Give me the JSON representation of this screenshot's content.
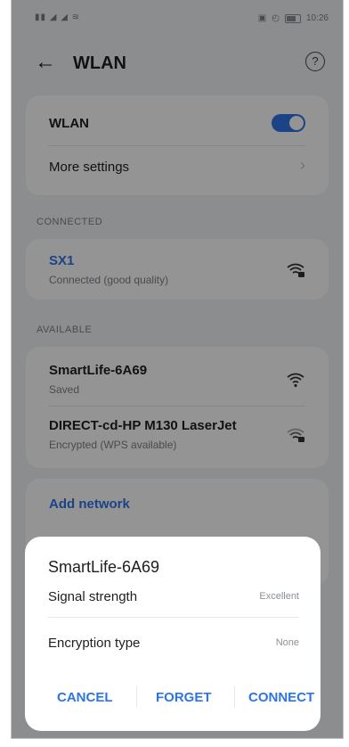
{
  "status_bar": {
    "left_icons": "▮▮ ◢ ◢ ≋",
    "time": "10:26"
  },
  "header": {
    "back_icon": "arrow-left-icon",
    "title": "WLAN",
    "help_icon": "help-icon"
  },
  "wlan_card": {
    "wlan_label": "WLAN",
    "wlan_enabled": true,
    "more_settings_label": "More settings"
  },
  "sections": {
    "connected_title": "CONNECTED",
    "available_title": "AVAILABLE"
  },
  "connected_network": {
    "name": "SX1",
    "status": "Connected (good quality)"
  },
  "available_networks": [
    {
      "name": "SmartLife-6A69",
      "status": "Saved"
    },
    {
      "name": "DIRECT-cd-HP M130 LaserJet",
      "status": "Encrypted (WPS available)"
    }
  ],
  "add_network_label": "Add network",
  "dialog": {
    "title": "SmartLife-6A69",
    "signal_strength_label": "Signal strength",
    "signal_strength_value": "Excellent",
    "encryption_type_label": "Encryption type",
    "encryption_type_value": "None",
    "cancel_label": "CANCEL",
    "forget_label": "FORGET",
    "connect_label": "CONNECT"
  },
  "colors": {
    "accent": "#2f74e6",
    "background": "#f1f3f5",
    "card": "#ffffff"
  }
}
